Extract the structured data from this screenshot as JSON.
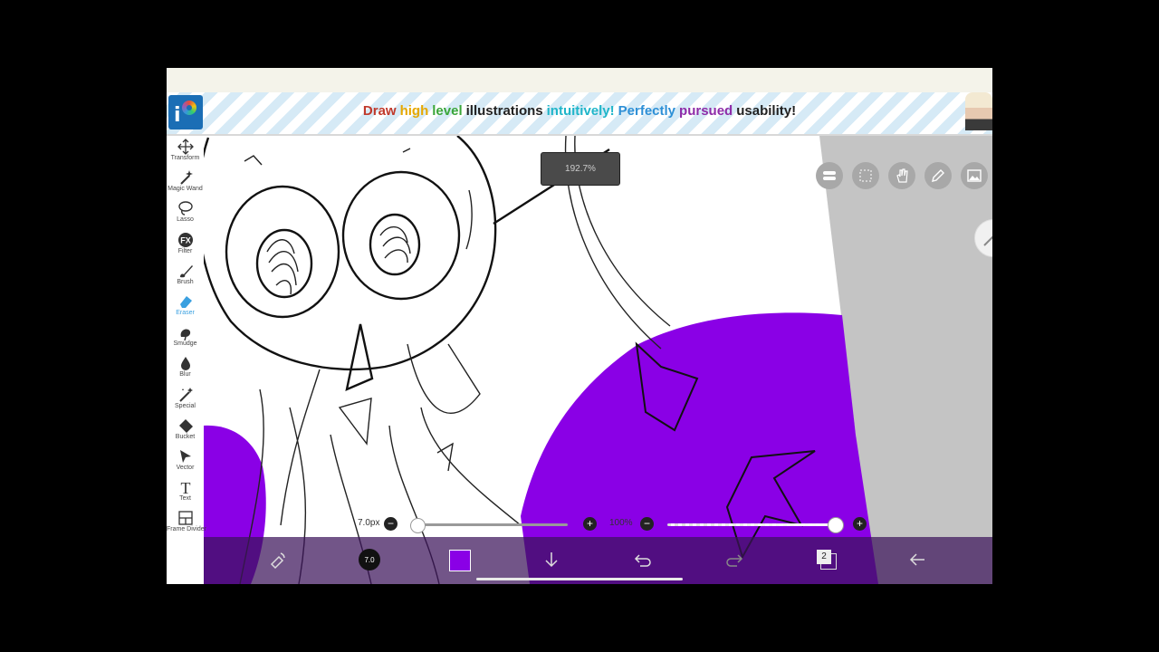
{
  "banner": {
    "words": [
      {
        "text": "Draw",
        "color": "#c0392b"
      },
      {
        "text": "high",
        "color": "#e6a800"
      },
      {
        "text": "level",
        "color": "#3aa63a"
      },
      {
        "text": "illustrations",
        "color": "#222222"
      },
      {
        "text": "intuitively!",
        "color": "#1fb5c9"
      },
      {
        "text": "Perfectly",
        "color": "#2d8fd6"
      },
      {
        "text": "pursued",
        "color": "#8e2ba8"
      },
      {
        "text": "usability!",
        "color": "#222222"
      }
    ]
  },
  "toolbar": {
    "tools": [
      {
        "label": "Transform",
        "icon": "move-icon"
      },
      {
        "label": "Magic Wand",
        "icon": "magic-wand-icon"
      },
      {
        "label": "Lasso",
        "icon": "lasso-icon"
      },
      {
        "label": "Filter",
        "icon": "fx-icon",
        "glyph": "FX"
      },
      {
        "label": "Brush",
        "icon": "brush-icon"
      },
      {
        "label": "Eraser",
        "icon": "eraser-icon",
        "active": true
      },
      {
        "label": "Smudge",
        "icon": "smudge-icon"
      },
      {
        "label": "Blur",
        "icon": "blur-drop-icon"
      },
      {
        "label": "Special",
        "icon": "special-icon"
      },
      {
        "label": "Bucket",
        "icon": "bucket-icon"
      },
      {
        "label": "Vector",
        "icon": "vector-cursor-icon"
      },
      {
        "label": "Text",
        "icon": "text-icon",
        "glyph": "T"
      },
      {
        "label": "Frame Divider",
        "icon": "frame-divider-icon"
      }
    ]
  },
  "zoom_badge": {
    "value": "192.7%"
  },
  "sliders": {
    "brush_size": {
      "label": "7.0px",
      "fraction": 0.02
    },
    "opacity": {
      "label": "100%",
      "fraction": 1.0
    }
  },
  "bottom_bar": {
    "brush_size_label": "7.0",
    "current_color": "#8a00e6",
    "layer_count": "2"
  },
  "colors": {
    "paint": "#8a00e6",
    "bottom_bar": "#3c145a",
    "active_tool": "#3aa0e0"
  }
}
